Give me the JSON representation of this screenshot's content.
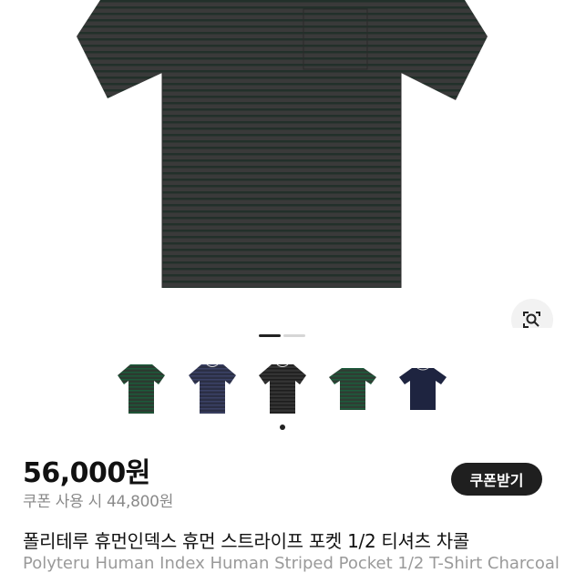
{
  "product": {
    "price": "56,000원",
    "coupon_price": "쿠폰 사용 시 44,800원",
    "coupon_button": "쿠폰받기",
    "title_ko": "폴리테루 휴먼인덱스 휴먼 스트라이프 포켓 1/2 티셔츠 차콜",
    "title_en": "Polyteru Human Index Human Striped Pocket 1/2 T-Shirt Charcoal"
  },
  "gallery": {
    "image_count": 2,
    "current_image": 1,
    "lens_icon": "lens-search-icon"
  },
  "thumbnails": [
    {
      "color_name": "green-stripe",
      "base": "#2c3a30",
      "stripe": "#1c5a3a"
    },
    {
      "color_name": "navy-stripe",
      "base": "#2b2f45",
      "stripe": "#3b4266"
    },
    {
      "color_name": "charcoal-stripe",
      "base": "#333333",
      "stripe": "#1d1d1d"
    },
    {
      "color_name": "green-stripe-2",
      "base": "#2f3d33",
      "stripe": "#1d5c3c"
    },
    {
      "color_name": "navy",
      "base": "#1e2440",
      "stripe": "#262d4f"
    }
  ],
  "colors": {
    "main_shirt_base": "#3a3a3a",
    "main_shirt_stripe": "#22302a"
  }
}
